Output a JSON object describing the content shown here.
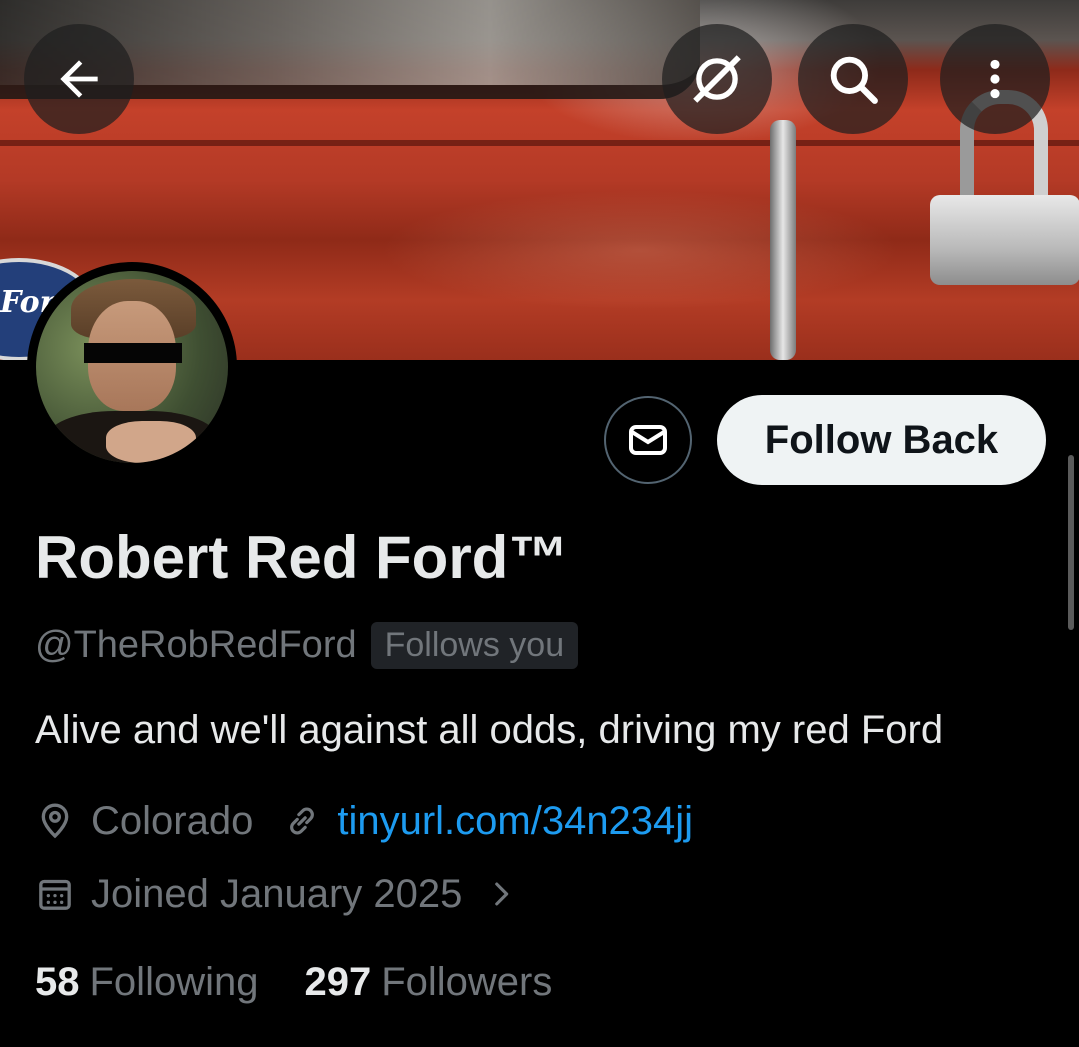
{
  "header": {
    "back_icon": "arrow-left-icon",
    "grok_icon": "grok-icon",
    "search_icon": "search-icon",
    "more_icon": "more-vertical-icon"
  },
  "banner": {
    "badge_text": "Ford"
  },
  "actions": {
    "message_icon": "mail-icon",
    "follow_back_label": "Follow Back"
  },
  "profile": {
    "display_name": "Robert Red Ford™",
    "handle": "@TheRobRedFord",
    "follows_you": "Follows you",
    "bio": "Alive and we'll against all odds, driving my red Ford",
    "location": "Colorado",
    "website": "tinyurl.com/34n234jj",
    "joined": "Joined January 2025"
  },
  "stats": {
    "following_count": "58",
    "following_label": "Following",
    "followers_count": "297",
    "followers_label": "Followers"
  },
  "colors": {
    "background": "#000000",
    "text_primary": "#e7e9ea",
    "text_secondary": "#71767b",
    "link": "#1d9bf0",
    "follow_button_bg": "#eff3f4"
  }
}
